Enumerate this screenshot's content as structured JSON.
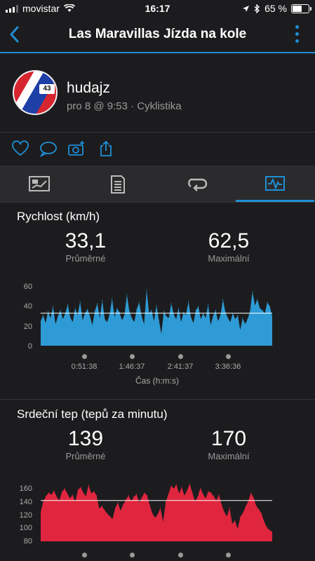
{
  "status_bar": {
    "carrier": "movistar",
    "time": "16:17",
    "battery": "65 %",
    "battery_level": 0.65
  },
  "nav": {
    "title": "Las Maravillas Jízda na kole",
    "icons": [
      "back-chevron-icon",
      "more-vertical-icon"
    ]
  },
  "profile": {
    "name": "hudajz",
    "meta": "pro 8 @ 9:53 · Cyklistika"
  },
  "actions": [
    "heart-icon",
    "comment-icon",
    "add-photo-icon",
    "share-icon"
  ],
  "tabs": [
    {
      "icon": "overview-icon",
      "active": false
    },
    {
      "icon": "details-icon",
      "active": false
    },
    {
      "icon": "laps-icon",
      "active": false
    },
    {
      "icon": "charts-icon",
      "active": true
    }
  ],
  "colors": {
    "accent": "#1f8fd6",
    "speed": "#2e9bd6",
    "heart": "#e0263f"
  },
  "speed_section": {
    "title": "Rychlost (km/h)",
    "avg": {
      "value": "33,1",
      "label": "Průměrné"
    },
    "max": {
      "value": "62,5",
      "label": "Maximální"
    },
    "x_axis_title": "Čas (h:m:s)"
  },
  "heart_section": {
    "title": "Srdeční tep (tepů za minutu)",
    "avg": {
      "value": "139",
      "label": "Průměrné"
    },
    "max": {
      "value": "170",
      "label": "Maximální"
    }
  },
  "chart_data": [
    {
      "type": "area",
      "ylim": [
        0,
        60
      ],
      "yticks": [
        "60",
        "40",
        "20",
        "0"
      ],
      "xticks": [
        "0:51:38",
        "1:46:37",
        "2:41:37",
        "3:36:36"
      ],
      "average_line": 33.1,
      "color": "#2e9bd6",
      "values": [
        25,
        31,
        23,
        35,
        28,
        40,
        22,
        30,
        36,
        27,
        33,
        42,
        29,
        24,
        38,
        31,
        45,
        26,
        33,
        37,
        30,
        21,
        35,
        43,
        28,
        46,
        27,
        24,
        32,
        48,
        29,
        38,
        34,
        26,
        31,
        52,
        35,
        28,
        24,
        37,
        44,
        30,
        22,
        57,
        33,
        36,
        25,
        41,
        26,
        12,
        35,
        30,
        28,
        43,
        32,
        27,
        38,
        24,
        34,
        31,
        45,
        29,
        23,
        36,
        40,
        27,
        33,
        28,
        42,
        21,
        30,
        36,
        25,
        31,
        47,
        34,
        28,
        24,
        33,
        27,
        31,
        16,
        28,
        22,
        27,
        35,
        55,
        41,
        47,
        38,
        36,
        33,
        44,
        40,
        30
      ]
    },
    {
      "type": "area",
      "ylim": [
        80,
        165
      ],
      "yticks": [
        "160",
        "140",
        "120",
        "100",
        "80"
      ],
      "average_line": 139,
      "color": "#e0263f",
      "values": [
        122,
        138,
        145,
        150,
        147,
        153,
        144,
        139,
        151,
        156,
        149,
        142,
        147,
        137,
        154,
        158,
        150,
        145,
        161,
        149,
        152,
        146,
        127,
        131,
        125,
        120,
        116,
        112,
        128,
        136,
        124,
        133,
        140,
        146,
        138,
        144,
        148,
        136,
        143,
        150,
        146,
        132,
        120,
        114,
        119,
        128,
        108,
        137,
        148,
        160,
        156,
        162,
        149,
        158,
        146,
        153,
        163,
        150,
        138,
        144,
        157,
        148,
        142,
        152,
        150,
        145,
        139,
        147,
        133,
        122,
        116,
        128,
        105,
        110,
        98,
        115,
        121,
        130,
        138,
        150,
        143,
        131,
        126,
        120,
        108,
        100,
        96,
        94
      ]
    }
  ]
}
